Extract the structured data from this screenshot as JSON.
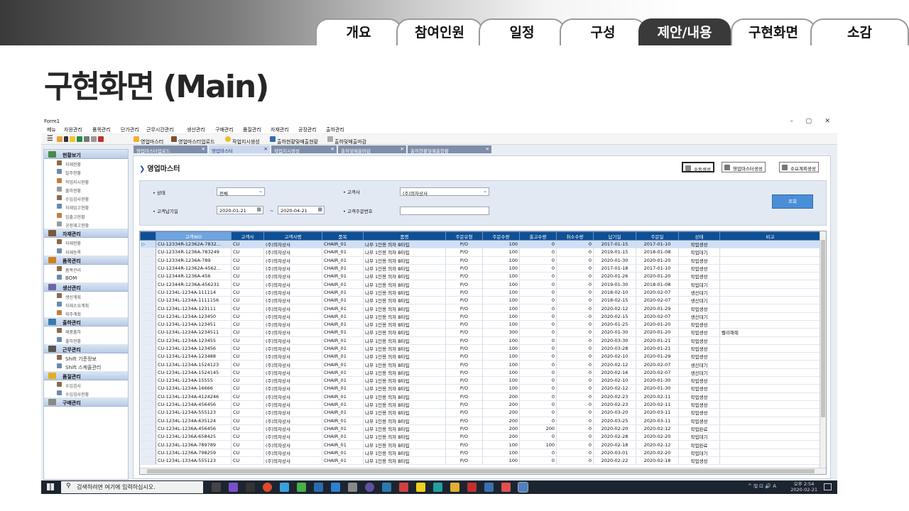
{
  "slide": {
    "tabs": [
      "개요",
      "참여인원",
      "일정",
      "구성",
      "제안/내용",
      "구현화면",
      "소감"
    ],
    "active_tab": "제안/내용",
    "title": "구현화면 (Main)"
  },
  "window": {
    "title": "Form1",
    "controls": [
      "–",
      "▢",
      "✕"
    ]
  },
  "menu": [
    "메뉴",
    "자원관리",
    "품목관리",
    "단가관리",
    "근무시간관리",
    "생산관리",
    "구매관리",
    "품질관리",
    "자재관리",
    "공장관리",
    "출하관리"
  ],
  "toolbar": [
    "영업마스터",
    "영업마스터업로드",
    "작업지시생성",
    "출하현황및매출현황",
    "출하및매출마감"
  ],
  "doc_tabs": [
    {
      "label": "영업마스터업로드",
      "selected": false
    },
    {
      "label": "영업마스터",
      "selected": true
    },
    {
      "label": "작업지시생성",
      "selected": false
    },
    {
      "label": "출하및매출마감",
      "selected": false
    },
    {
      "label": "출하현황및매출현황",
      "selected": false
    }
  ],
  "sidebar": [
    {
      "head": "현황보기",
      "items": [
        "자재현황",
        "발주현황",
        "작업지시현황",
        "출하현황",
        "수입검사현황",
        "자재입고현황",
        "입출고현황",
        "공정재고현황"
      ]
    },
    {
      "head": "자재관리",
      "items": [
        "자재현황",
        "자재등록"
      ]
    },
    {
      "head": "품목관리",
      "items": [
        "품목관리",
        "BOM"
      ]
    },
    {
      "head": "생산관리",
      "items": [
        "생산계획",
        "자재소요계획",
        "외주계획"
      ]
    },
    {
      "head": "출하관리",
      "items": [
        "제품출하",
        "출하현황"
      ]
    },
    {
      "head": "근무관리",
      "items": [
        "Shift 기준정보",
        "Shift 스케줄관리"
      ]
    },
    {
      "head": "품질관리",
      "items": [
        "수입검사",
        "수입검사현황"
      ]
    },
    {
      "head": "구매관리",
      "items": []
    }
  ],
  "panel": {
    "title": "영업마스터",
    "buttons": [
      "수동생성",
      "영업마스터생성",
      "수요계획생성"
    ],
    "filters": {
      "status_label": "• 상태",
      "status_value": "전체",
      "customer_label": "• 고객사",
      "customer_value": "(주)의자상사",
      "due_label": "• 고객납기일",
      "due_from": "2020-01-21",
      "due_sep": "~",
      "due_to": "2020-04-21",
      "order_no_label": "• 고객주문번호",
      "order_no_value": "",
      "search_button": "조회"
    }
  },
  "grid": {
    "columns": [
      "고객WO",
      "고객사",
      "고객사명",
      "품목",
      "품명",
      "주문유형",
      "주문수량",
      "출고수량",
      "취소수량",
      "납기일",
      "주문일",
      "상태",
      "비고"
    ],
    "rows": [
      [
        "CU-12334R-12362A-7832...",
        "CU",
        "(주)의자상사",
        "CHAIR_01",
        "나무 1인용 의자 B타입",
        "P/O",
        "100",
        "0",
        "0",
        "2017-01-15",
        "2017-01-10",
        "작업생성",
        ""
      ],
      [
        "CU-12334R-1236A-783249",
        "CU",
        "(주)의자상사",
        "CHAIR_01",
        "나무 1인용 의자 B타입",
        "P/O",
        "100",
        "0",
        "0",
        "2019-01-15",
        "2018-01-08",
        "작업대기",
        ""
      ],
      [
        "CU-12334R-1236A-789",
        "CU",
        "(주)의자상사",
        "CHAIR_01",
        "나무 1인용 의자 B타입",
        "P/O",
        "100",
        "0",
        "0",
        "2020-01-30",
        "2020-01-20",
        "작업생성",
        ""
      ],
      [
        "CU-12344R-12362A-4562...",
        "CU",
        "(주)의자상사",
        "CHAIR_01",
        "나무 1인용 의자 B타입",
        "P/O",
        "100",
        "0",
        "0",
        "2017-01-18",
        "2017-01-10",
        "작업생성",
        ""
      ],
      [
        "CU-12344R-1236A-456",
        "CU",
        "(주)의자상사",
        "CHAIR_01",
        "나무 1인용 의자 B타입",
        "P/O",
        "100",
        "0",
        "0",
        "2020-01-26",
        "2020-01-20",
        "작업생성",
        ""
      ],
      [
        "CU-12344R-1236A-456231",
        "CU",
        "(주)의자상사",
        "CHAIR_01",
        "나무 1인용 의자 B타입",
        "P/O",
        "100",
        "0",
        "0",
        "2019-01-30",
        "2018-01-08",
        "작업대기",
        ""
      ],
      [
        "CU-1234L-1234A-111114",
        "CU",
        "(주)의자상사",
        "CHAIR_01",
        "나무 1인용 의자 B타입",
        "P/O",
        "100",
        "0",
        "0",
        "2018-02-10",
        "2020-02-07",
        "생산대기",
        ""
      ],
      [
        "CU-1234L-1234A-1111156",
        "CU",
        "(주)의자상사",
        "CHAIR_01",
        "나무 1인용 의자 B타입",
        "P/O",
        "100",
        "0",
        "0",
        "2018-02-15",
        "2020-02-07",
        "생산대기",
        ""
      ],
      [
        "CU-1234L-1234A-123111",
        "CU",
        "(주)의자상사",
        "CHAIR_01",
        "나무 1인용 의자 B타입",
        "P/O",
        "100",
        "0",
        "0",
        "2020-02-12",
        "2020-01-29",
        "작업생성",
        ""
      ],
      [
        "CU-1234L-1234A-123450",
        "CU",
        "(주)의자상사",
        "CHAIR_01",
        "나무 1인용 의자 B타입",
        "P/O",
        "100",
        "0",
        "0",
        "2020-02-15",
        "2020-02-07",
        "생산대기",
        ""
      ],
      [
        "CU-1234L-1234A-123451",
        "CU",
        "(주)의자상사",
        "CHAIR_01",
        "나무 1인용 의자 B타입",
        "P/O",
        "100",
        "0",
        "0",
        "2020-01-25",
        "2020-01-20",
        "작업생성",
        ""
      ],
      [
        "CU-1234L-1234A-1234511",
        "CU",
        "(주)의자상사",
        "CHAIR_01",
        "나무 1인용 의자 B타입",
        "P/O",
        "300",
        "0",
        "0",
        "2020-01-30",
        "2020-01-20",
        "작업생성",
        "빨리해줘"
      ],
      [
        "CU-1234L-1234A-123455",
        "CU",
        "(주)의자상사",
        "CHAIR_01",
        "나무 1인용 의자 B타입",
        "P/O",
        "100",
        "0",
        "0",
        "2020-03-30",
        "2020-01-21",
        "작업생성",
        ""
      ],
      [
        "CU-1234L-1234A-123456",
        "CU",
        "(주)의자상사",
        "CHAIR_01",
        "나무 1인용 의자 B타입",
        "P/O",
        "100",
        "0",
        "0",
        "2020-03-28",
        "2020-01-21",
        "작업생성",
        ""
      ],
      [
        "CU-1234L-1234A-123488",
        "CU",
        "(주)의자상사",
        "CHAIR_01",
        "나무 1인용 의자 B타입",
        "P/O",
        "100",
        "0",
        "0",
        "2020-02-10",
        "2020-01-29",
        "작업생성",
        ""
      ],
      [
        "CU-1234L-1234A-1524123",
        "CU",
        "(주)의자상사",
        "CHAIR_01",
        "나무 1인용 의자 B타입",
        "P/O",
        "100",
        "0",
        "0",
        "2020-02-12",
        "2020-02-07",
        "생산대기",
        ""
      ],
      [
        "CU-1234L-1234A-1524145",
        "CU",
        "(주)의자상사",
        "CHAIR_01",
        "나무 1인용 의자 B타입",
        "P/O",
        "100",
        "0",
        "0",
        "2020-02-16",
        "2020-02-07",
        "생산대기",
        ""
      ],
      [
        "CU-1234L-1234A-15555",
        "CU",
        "(주)의자상사",
        "CHAIR_01",
        "나무 1인용 의자 B타입",
        "P/O",
        "100",
        "0",
        "0",
        "2020-02-10",
        "2020-01-30",
        "작업생성",
        ""
      ],
      [
        "CU-1234L-1234A-16666",
        "CU",
        "(주)의자상사",
        "CHAIR_01",
        "나무 1인용 의자 B타입",
        "P/O",
        "100",
        "0",
        "0",
        "2020-02-12",
        "2020-01-30",
        "작업생성",
        ""
      ],
      [
        "CU-1234L-1234A-4124246",
        "CU",
        "(주)의자상사",
        "CHAIR_01",
        "나무 1인용 의자 B타입",
        "P/O",
        "200",
        "0",
        "0",
        "2020-02-23",
        "2020-02-11",
        "작업생성",
        ""
      ],
      [
        "CU-1234L-1234A-456456",
        "CU",
        "(주)의자상사",
        "CHAIR_01",
        "나무 1인용 의자 B타입",
        "P/O",
        "200",
        "0",
        "0",
        "2020-02-23",
        "2020-02-11",
        "작업생성",
        ""
      ],
      [
        "CU-1234L-1234A-555123",
        "CU",
        "(주)의자상사",
        "CHAIR_01",
        "나무 1인용 의자 B타입",
        "P/O",
        "200",
        "0",
        "0",
        "2020-03-20",
        "2020-03-11",
        "작업생성",
        ""
      ],
      [
        "CU-1234L-1234A-635124",
        "CU",
        "(주)의자상사",
        "CHAIR_01",
        "나무 1인용 의자 B타입",
        "P/O",
        "200",
        "0",
        "0",
        "2020-03-25",
        "2020-03-11",
        "작업생성",
        ""
      ],
      [
        "CU-1234L-1236A-456456",
        "CU",
        "(주)의자상사",
        "CHAIR_01",
        "나무 1인용 의자 B타입",
        "P/O",
        "200",
        "200",
        "0",
        "2020-02-20",
        "2020-02-12",
        "작업완료",
        ""
      ],
      [
        "CU-1234L-1236A-658425",
        "CU",
        "(주)의자상사",
        "CHAIR_01",
        "나무 1인용 의자 B타입",
        "P/O",
        "200",
        "0",
        "0",
        "2020-02-28",
        "2020-02-20",
        "작업대기",
        ""
      ],
      [
        "CU-1234L-1236A-789789",
        "CU",
        "(주)의자상사",
        "CHAIR_01",
        "나무 1인용 의자 B타입",
        "P/O",
        "100",
        "100",
        "0",
        "2020-02-18",
        "2020-02-12",
        "작업완료",
        ""
      ],
      [
        "CU-1234L-1236A-798259",
        "CU",
        "(주)의자상사",
        "CHAIR_01",
        "나무 1인용 의자 B타입",
        "P/O",
        "100",
        "0",
        "0",
        "2020-03-01",
        "2020-02-20",
        "작업대기",
        ""
      ],
      [
        "CU-1234L-1334A-555123",
        "CU",
        "(주)의자상사",
        "CHAIR_01",
        "나무 1인용 의자 B타입",
        "P/O",
        "100",
        "0",
        "0",
        "2020-02-22",
        "2020-02-18",
        "작업생성",
        ""
      ]
    ]
  },
  "taskbar": {
    "search_placeholder": "검색하려면 여기에 입력하십시오.",
    "tray": "^ 🖫 ⊡ 🔊 A",
    "time": "오후 2:54",
    "date": "2020-02-21"
  }
}
